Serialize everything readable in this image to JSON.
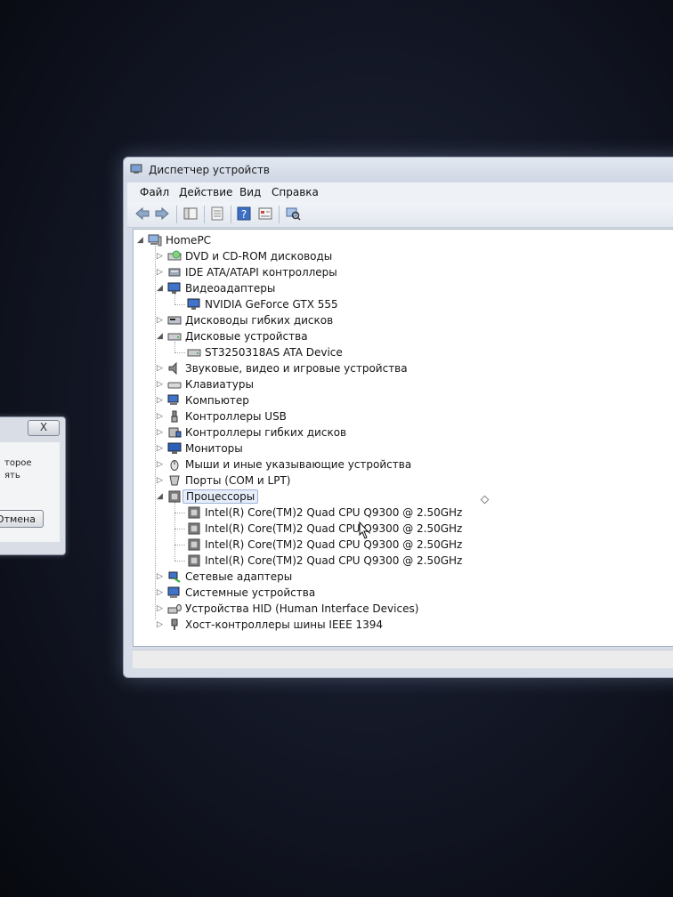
{
  "background_dialog": {
    "close_label": "X",
    "text_line1": "торое",
    "text_line2": "ять",
    "cancel_label": "Отмена"
  },
  "window": {
    "title": "Диспетчер устройств",
    "menu": [
      "Файл",
      "Действие",
      "Вид",
      "Справка"
    ],
    "toolbar_icons": [
      "back-arrow-icon",
      "forward-arrow-icon",
      "show-hide-tree-icon",
      "properties-icon",
      "help-icon",
      "view-icon",
      "scan-hardware-icon"
    ]
  },
  "tree": {
    "root": "HomePC",
    "items": [
      {
        "label": "DVD и CD-ROM дисководы",
        "icon": "dvd-drive-icon",
        "expanded": false
      },
      {
        "label": "IDE ATA/ATAPI контроллеры",
        "icon": "ide-controller-icon",
        "expanded": false
      },
      {
        "label": "Видеоадаптеры",
        "icon": "display-adapter-icon",
        "expanded": true
      },
      {
        "label": "NVIDIA GeForce GTX 555",
        "icon": "display-adapter-icon",
        "child": true
      },
      {
        "label": "Дисководы гибких дисков",
        "icon": "floppy-drive-icon",
        "expanded": false
      },
      {
        "label": "Дисковые устройства",
        "icon": "disk-drive-icon",
        "expanded": true
      },
      {
        "label": "ST3250318AS ATA Device",
        "icon": "disk-drive-icon",
        "child": true
      },
      {
        "label": "Звуковые, видео и игровые устройства",
        "icon": "speaker-icon",
        "expanded": false
      },
      {
        "label": "Клавиатуры",
        "icon": "keyboard-icon",
        "expanded": false
      },
      {
        "label": "Компьютер",
        "icon": "computer-icon",
        "expanded": false
      },
      {
        "label": "Контроллеры USB",
        "icon": "usb-icon",
        "expanded": false
      },
      {
        "label": "Контроллеры гибких дисков",
        "icon": "floppy-controller-icon",
        "expanded": false
      },
      {
        "label": "Мониторы",
        "icon": "monitor-icon",
        "expanded": false
      },
      {
        "label": "Мыши и иные указывающие устройства",
        "icon": "mouse-icon",
        "expanded": false
      },
      {
        "label": "Порты (COM и LPT)",
        "icon": "port-icon",
        "expanded": false
      },
      {
        "label": "Процессоры",
        "icon": "processor-icon",
        "expanded": true,
        "selected": true
      },
      {
        "label": "Intel(R) Core(TM)2 Quad  CPU   Q9300  @ 2.50GHz",
        "icon": "processor-icon",
        "child": true
      },
      {
        "label": "Intel(R) Core(TM)2 Quad  CPU   Q9300  @ 2.50GHz",
        "icon": "processor-icon",
        "child": true
      },
      {
        "label": "Intel(R) Core(TM)2 Quad  CPU   Q9300  @ 2.50GHz",
        "icon": "processor-icon",
        "child": true
      },
      {
        "label": "Intel(R) Core(TM)2 Quad  CPU   Q9300  @ 2.50GHz",
        "icon": "processor-icon",
        "child": true
      },
      {
        "label": "Сетевые адаптеры",
        "icon": "network-adapter-icon",
        "expanded": false
      },
      {
        "label": "Системные устройства",
        "icon": "system-device-icon",
        "expanded": false
      },
      {
        "label": "Устройства HID (Human Interface Devices)",
        "icon": "hid-icon",
        "expanded": false
      },
      {
        "label": "Хост-контроллеры шины IEEE 1394",
        "icon": "ieee1394-icon",
        "expanded": false
      }
    ]
  }
}
